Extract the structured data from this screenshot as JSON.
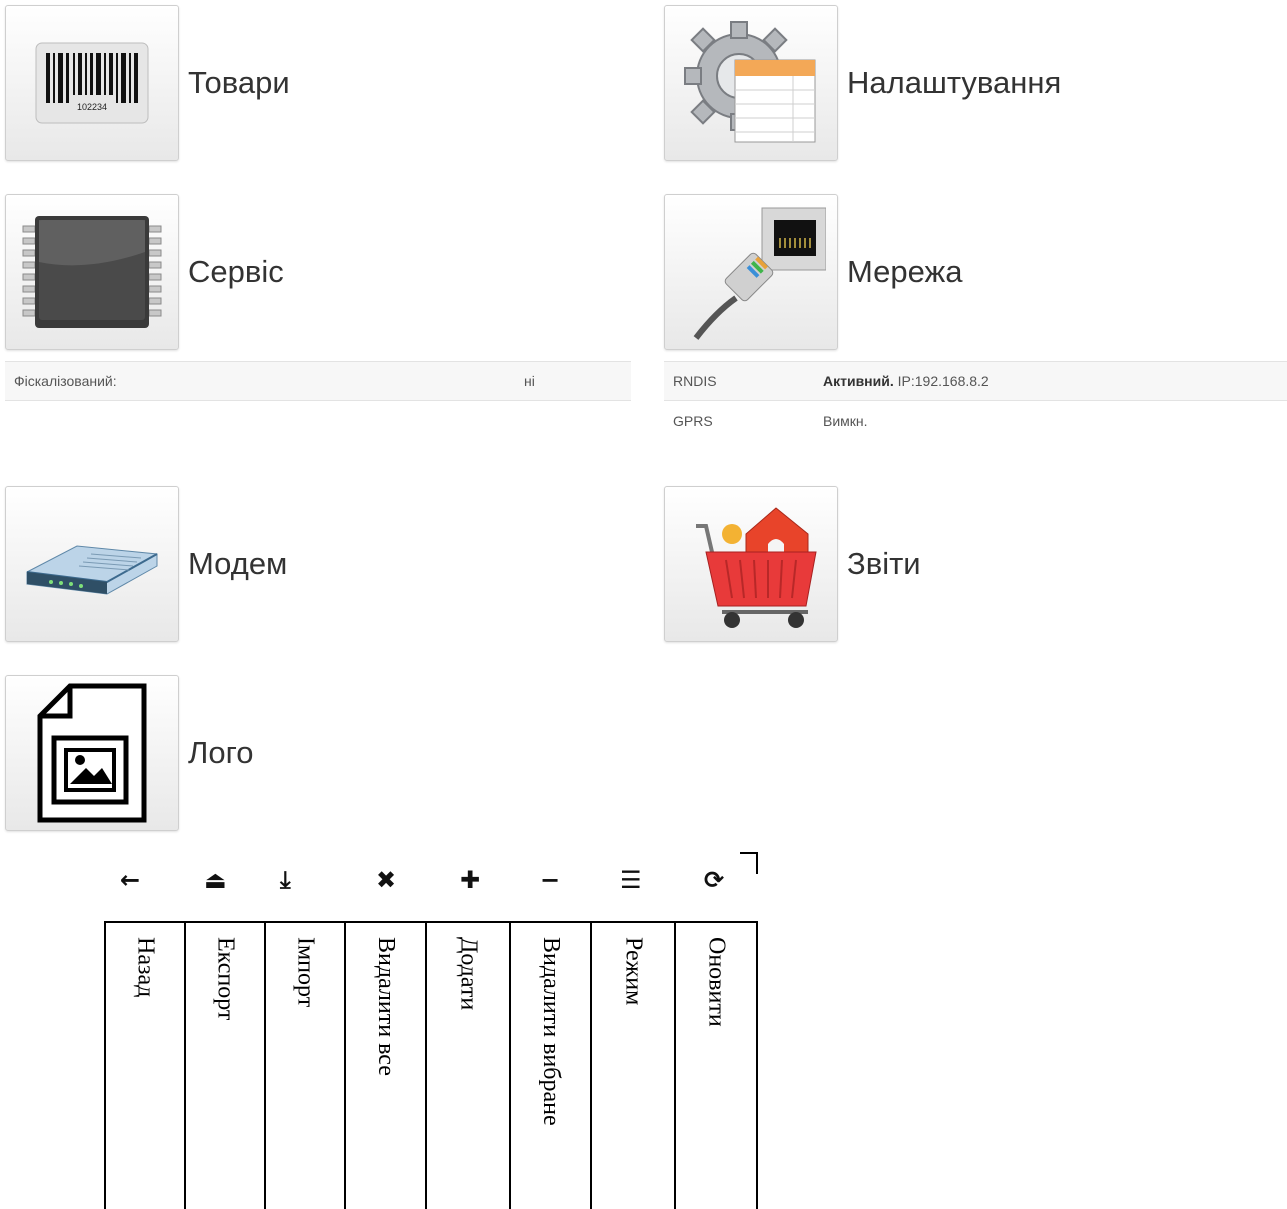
{
  "tiles": {
    "goods": {
      "label": "Товари",
      "barcode_number": "102234"
    },
    "settings": {
      "label": "Налаштування"
    },
    "service": {
      "label": "Сервіс"
    },
    "network": {
      "label": "Мережа"
    },
    "modem": {
      "label": "Модем"
    },
    "reports": {
      "label": "Звіти"
    },
    "logo": {
      "label": "Лого"
    }
  },
  "service_info": {
    "rows": [
      {
        "label": "Фіскалізований:",
        "value": "ні"
      }
    ]
  },
  "network_info": {
    "rows": [
      {
        "label": "RNDIS",
        "status": "Активний.",
        "detail": "IP:192.168.8.2"
      },
      {
        "label": "GPRS",
        "status": "Вимкн."
      }
    ]
  },
  "toolbar": {
    "icons": [
      "arrow-left-icon",
      "export-icon",
      "import-icon",
      "close-icon",
      "plus-icon",
      "minus-icon",
      "list-icon",
      "refresh-icon"
    ],
    "labels": [
      "Назад",
      "Експорт",
      "Імпорт",
      "Видалити все",
      "Додати",
      "Видалити вибране",
      "Режим",
      "Оновити"
    ]
  },
  "colors": {
    "tile_border": "#cfcfcf",
    "row_stripe": "#f7f7f7",
    "text": "#333333"
  }
}
